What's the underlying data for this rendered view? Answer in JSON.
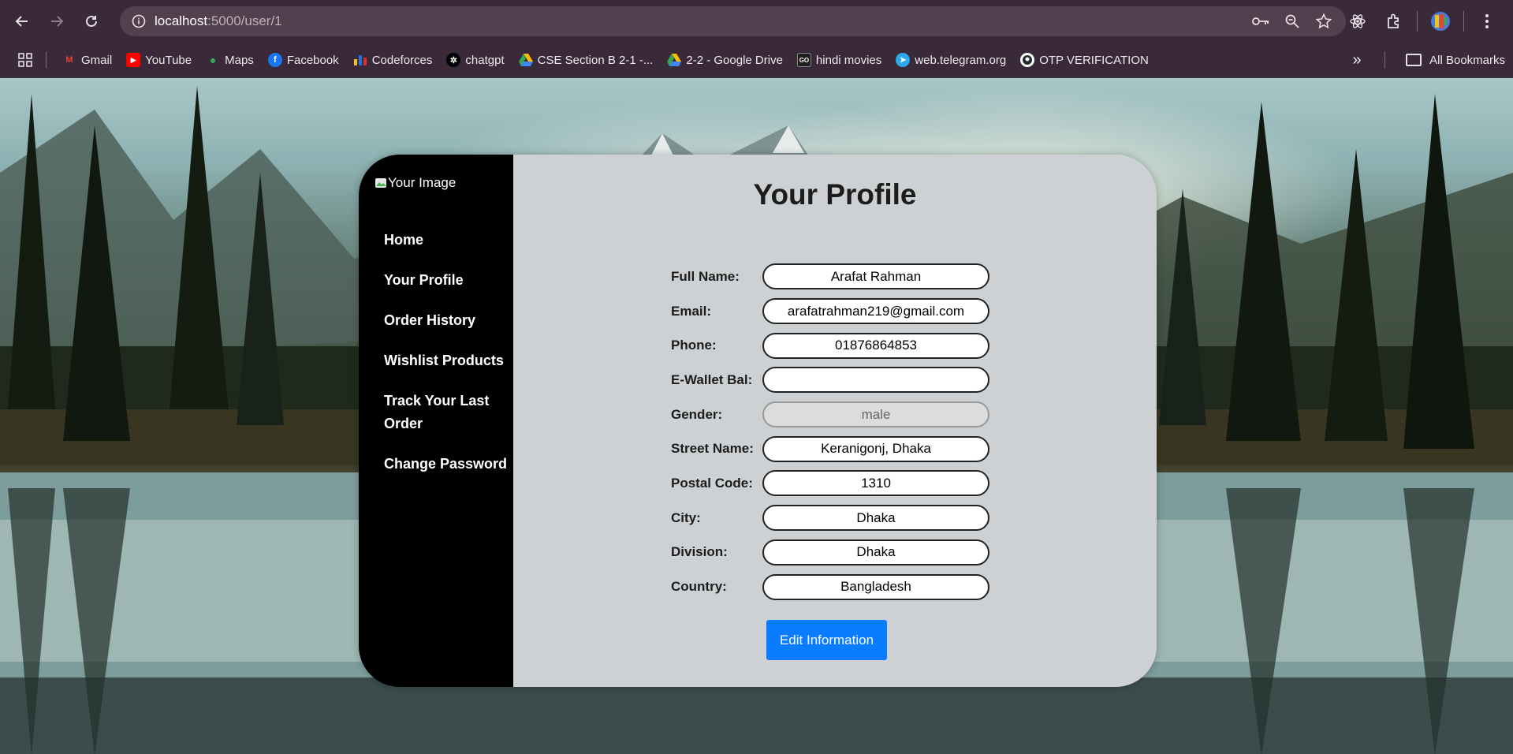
{
  "browser": {
    "url_host": "localhost",
    "url_path": ":5000/user/1",
    "bookmarks": [
      {
        "label": "Gmail",
        "icon": "gmail-icon",
        "color": "#ea4335"
      },
      {
        "label": "YouTube",
        "icon": "youtube-icon",
        "color": "#ff0000"
      },
      {
        "label": "Maps",
        "icon": "maps-icon",
        "color": "#34a853"
      },
      {
        "label": "Facebook",
        "icon": "facebook-icon",
        "color": "#1877f2"
      },
      {
        "label": "Codeforces",
        "icon": "codeforces-icon",
        "color": "#f4c20d"
      },
      {
        "label": "chatgpt",
        "icon": "chatgpt-icon",
        "color": "#ffffff"
      },
      {
        "label": "CSE Section B 2-1 -...",
        "icon": "google-drive-icon",
        "color": "#34a853"
      },
      {
        "label": "2-2 - Google Drive",
        "icon": "google-drive-icon",
        "color": "#34a853"
      },
      {
        "label": "hindi movies",
        "icon": "goku-icon",
        "color": "#ffffff"
      },
      {
        "label": "web.telegram.org",
        "icon": "telegram-icon",
        "color": "#2aabee"
      },
      {
        "label": "OTP VERIFICATION",
        "icon": "github-icon",
        "color": "#ffffff"
      }
    ],
    "all_bookmarks": "All Bookmarks"
  },
  "sidebar": {
    "image_alt": "Your Image",
    "items": [
      {
        "label": "Home"
      },
      {
        "label": "Your Profile"
      },
      {
        "label": "Order History"
      },
      {
        "label": "Wishlist Products"
      },
      {
        "label": "Track Your Last Order"
      },
      {
        "label": "Change Password"
      }
    ]
  },
  "profile": {
    "title": "Your Profile",
    "fields": [
      {
        "label": "Full Name:",
        "value": "Arafat Rahman"
      },
      {
        "label": "Email:",
        "value": "arafatrahman219@gmail.com"
      },
      {
        "label": "Phone:",
        "value": "01876864853"
      },
      {
        "label": "E-Wallet Bal:",
        "value": ""
      },
      {
        "label": "Gender:",
        "value": "male",
        "readonly": true
      },
      {
        "label": "Street Name:",
        "value": "Keranigonj, Dhaka"
      },
      {
        "label": "Postal Code:",
        "value": "1310"
      },
      {
        "label": "City:",
        "value": "Dhaka"
      },
      {
        "label": "Division:",
        "value": "Dhaka"
      },
      {
        "label": "Country:",
        "value": "Bangladesh"
      }
    ],
    "edit_button": "Edit Information"
  },
  "colors": {
    "accent": "#0a7cff",
    "sidebar_bg": "#000000",
    "panel_bg": "#cdd1d3"
  }
}
